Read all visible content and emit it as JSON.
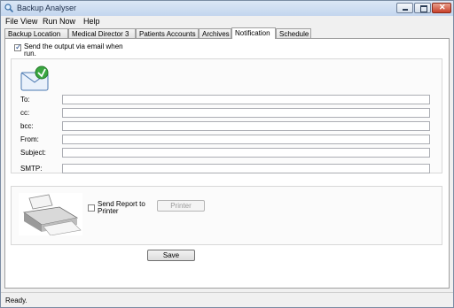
{
  "window": {
    "title": "Backup Analyser"
  },
  "menu": [
    "File",
    "View",
    "Run Now",
    "Help"
  ],
  "tabs": [
    {
      "label": "Backup Location"
    },
    {
      "label": "Medical Director 3"
    },
    {
      "label": "Patients Accounts"
    },
    {
      "label": "Archives"
    },
    {
      "label": "Notification",
      "active": true
    },
    {
      "label": "Schedule"
    }
  ],
  "notification": {
    "email_checkbox_label_line1": "Send the output via email when",
    "email_checkbox_label_line2": "run.",
    "email_checked": true,
    "fields": {
      "to_label": "To:",
      "cc_label": "cc:",
      "bcc_label": "bcc:",
      "from_label": "From:",
      "subject_label": "Subject:",
      "smtp_label": "SMTP:"
    },
    "printer_checkbox_label_line1": "Send Report to",
    "printer_checkbox_label_line2": "Printer",
    "printer_checked": false,
    "printer_button": "Printer",
    "save_button": "Save"
  },
  "status": {
    "text": "Ready."
  },
  "icons": {
    "app": "magnifier-icon",
    "email": "email-envelope-icon",
    "printer": "printer-image"
  }
}
